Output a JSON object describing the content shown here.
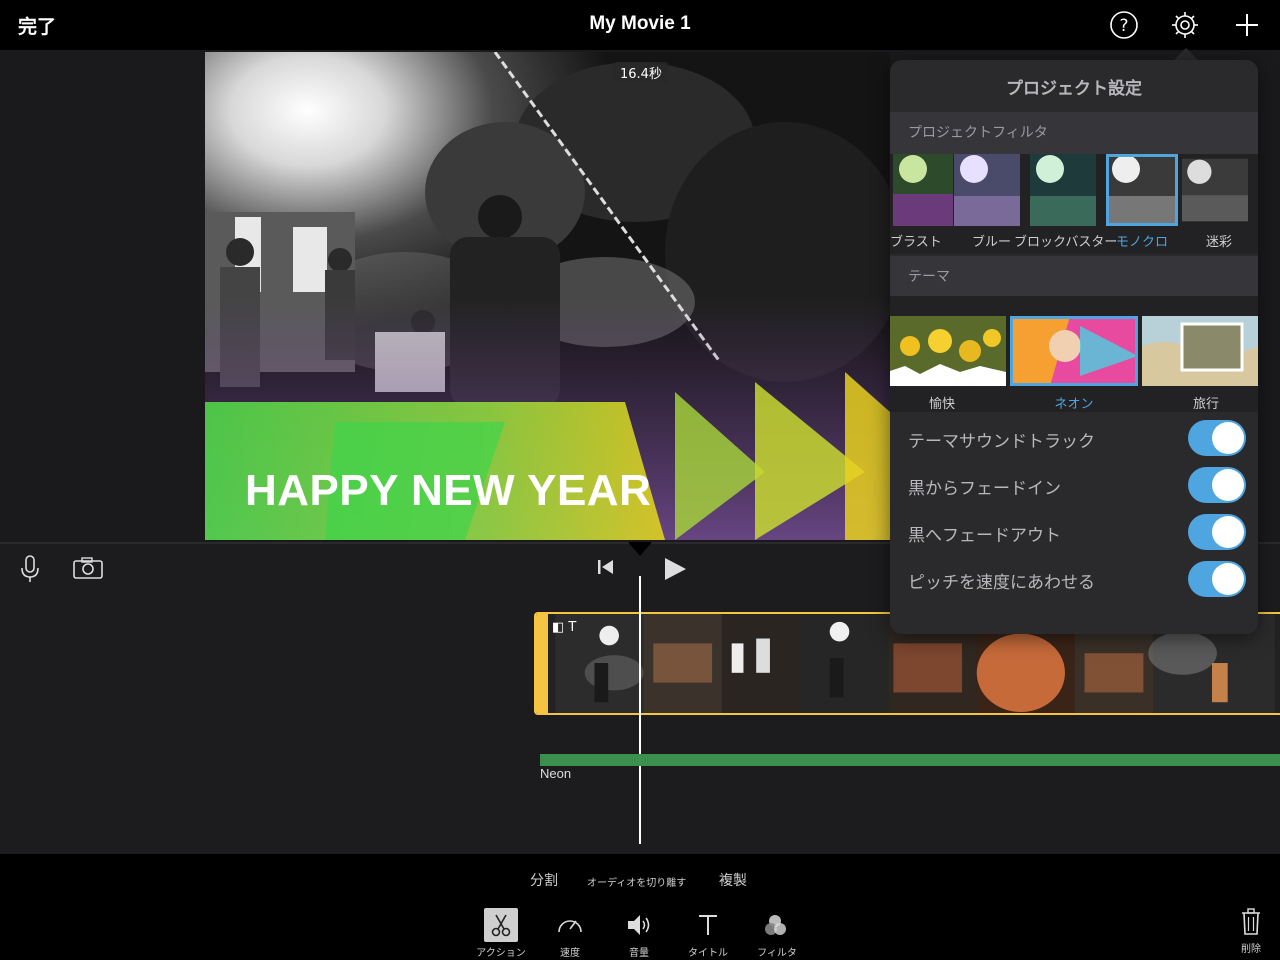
{
  "topbar": {
    "done_label": "完了",
    "title": "My Movie 1",
    "icons": [
      "help-icon",
      "gear-icon",
      "plus-icon"
    ]
  },
  "viewer": {
    "duration": "16.4秒",
    "overlay_title": "HAPPY NEW YEAR"
  },
  "timeline": {
    "icons": [
      "microphone-icon",
      "camera-icon",
      "skip-back-icon",
      "play-icon"
    ],
    "clip_badges": "◧ T",
    "audio_label": "Neon",
    "accent_color": "#f5c542",
    "audio_color": "#3d8f4e"
  },
  "toolbar": {
    "sub_actions": [
      "分割",
      "オーディオを切り離す",
      "複製"
    ],
    "tools": [
      {
        "label": "アクション",
        "icon": "scissors-icon",
        "active": true
      },
      {
        "label": "速度",
        "icon": "speedometer-icon",
        "active": false
      },
      {
        "label": "音量",
        "icon": "speaker-icon",
        "active": false
      },
      {
        "label": "タイトル",
        "icon": "title-t-icon",
        "active": false
      },
      {
        "label": "フィルタ",
        "icon": "filter-circles-icon",
        "active": false
      }
    ],
    "delete_label": "削除"
  },
  "settings": {
    "title": "プロジェクト設定",
    "filter_section": "プロジェクトフィルタ",
    "filters": [
      {
        "label": "ブラスト",
        "selected": false
      },
      {
        "label": "ブルー",
        "selected": false
      },
      {
        "label": "ブロックバスター",
        "selected": false
      },
      {
        "label": "モノクロ",
        "selected": true
      },
      {
        "label": "迷彩",
        "selected": false
      }
    ],
    "theme_section": "テーマ",
    "themes": [
      {
        "label": "愉快",
        "selected": false
      },
      {
        "label": "ネオン",
        "selected": true
      },
      {
        "label": "旅行",
        "selected": false
      }
    ],
    "toggles": [
      {
        "label": "テーマサウンドトラック",
        "on": true
      },
      {
        "label": "黒からフェードイン",
        "on": true
      },
      {
        "label": "黒へフェードアウト",
        "on": true
      },
      {
        "label": "ピッチを速度にあわせる",
        "on": true
      }
    ],
    "accent_color": "#4ea5e0"
  }
}
